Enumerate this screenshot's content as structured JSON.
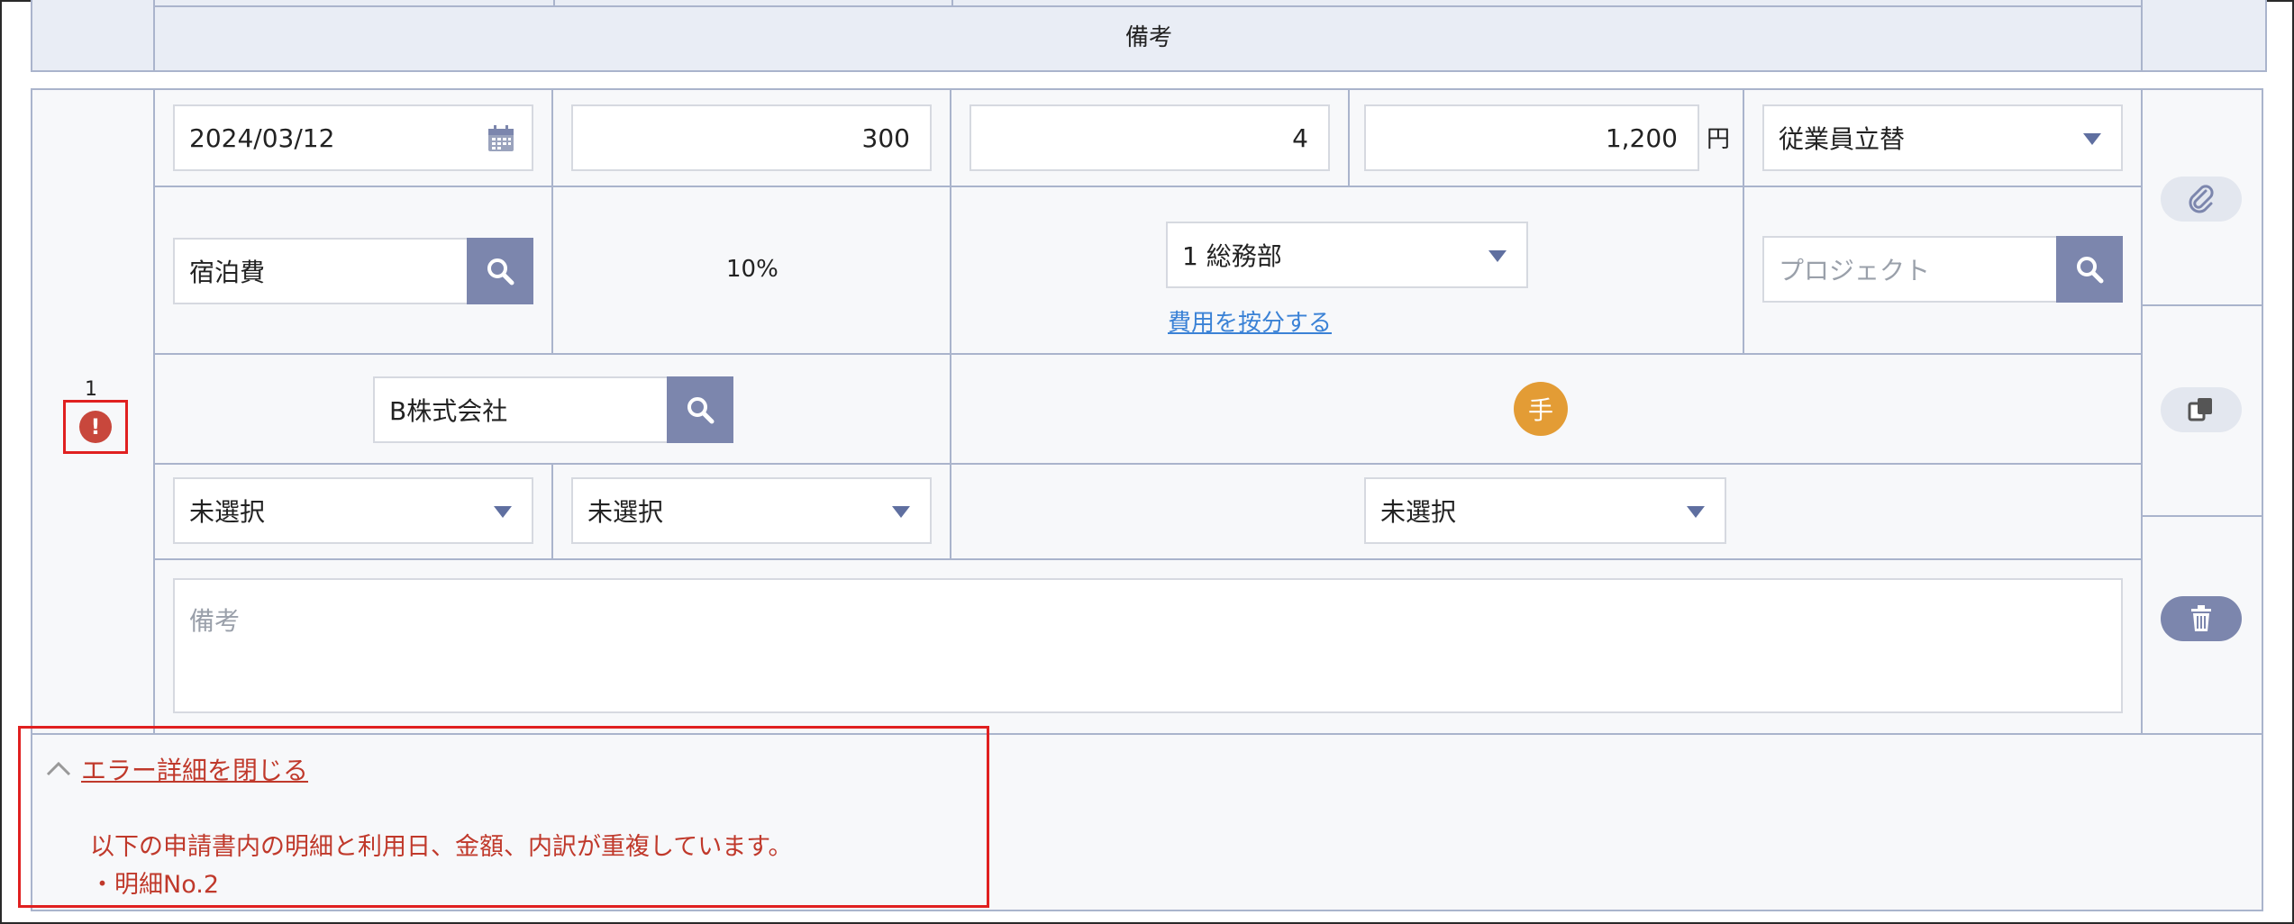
{
  "header": {
    "remarks_label": "備考"
  },
  "row": {
    "number": "1",
    "date": {
      "value": "2024/03/12"
    },
    "unit_price": {
      "value": "300"
    },
    "quantity": {
      "value": "4"
    },
    "amount": {
      "value": "1,200",
      "unit": "円"
    },
    "payment_method": {
      "selected": "従業員立替"
    },
    "expense_item": {
      "value": "宿泊費"
    },
    "tax_rate": "10%",
    "department": {
      "selected": "1 総務部"
    },
    "allocate_link": "費用を按分する",
    "project": {
      "placeholder": "プロジェクト"
    },
    "vendor": {
      "value": "B株式会社"
    },
    "manual_badge": "手",
    "select_1": {
      "selected": "未選択"
    },
    "select_2": {
      "selected": "未選択"
    },
    "select_3": {
      "selected": "未選択"
    },
    "remarks": {
      "placeholder": "備考"
    }
  },
  "error": {
    "toggle_label": "エラー詳細を閉じる",
    "message": "以下の申請書内の明細と利用日、金額、内訳が重複しています。",
    "item": "・明細No.2"
  },
  "colors": {
    "accent": "#7c86ad",
    "error": "#c0392b",
    "link": "#3b82d6",
    "badge": "#e39c35",
    "highlight_box": "#e02020"
  },
  "icons": [
    "calendar-icon",
    "search-icon",
    "caret-down-icon",
    "clip-icon",
    "copy-icon",
    "trash-icon",
    "error-icon",
    "chevron-up-icon"
  ]
}
